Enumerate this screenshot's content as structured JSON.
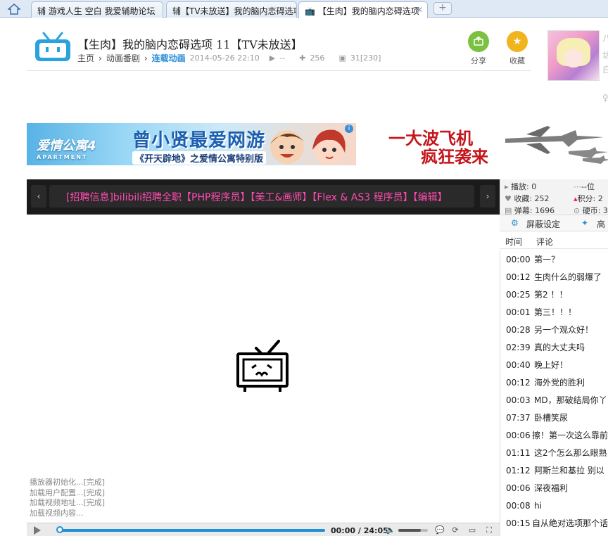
{
  "tabs": [
    {
      "label": "辅 游戏人生 空白 我爱辅助论坛",
      "active": false
    },
    {
      "label": "辅【TV未放送】我的脑内恋碍选项",
      "active": false
    },
    {
      "label": "【生肉】我的脑内恋碍选项",
      "active": true
    }
  ],
  "newtab": "+",
  "header": {
    "title": "【生肉】我的脑内恋碍选项 11【TV未放送】",
    "crumbs": [
      "主页",
      "动画番剧",
      "连载动画"
    ],
    "date": "2014-05-26 22:10",
    "plays": "--",
    "favs": "256",
    "danmaku": "31[230]",
    "share_label": "分享",
    "collect_label": "收藏"
  },
  "ads": {
    "ad1_brand": "爱情公寓4",
    "ad1_brand_sub": "APARTMENT",
    "ad1_big": "曾小贤最爱网游",
    "ad1_small": "《开天辟地》之爱情公寓特别版",
    "ad2_line1": "一大波飞机",
    "ad2_line2": "疯狂袭来"
  },
  "notice": {
    "message": "[招聘信息]bilibili招聘全职【PHP程序员】【美工&画师】【Flex & AS3 程序员】【编辑】"
  },
  "player": {
    "log": [
      "播放器初始化...[完成]",
      "加载用户配置...[完成]",
      "加载视频地址...[完成]",
      "加载视频内容..."
    ],
    "time_current": "00:00",
    "time_sep": "/",
    "time_total": "24:05",
    "progress": 0
  },
  "stats": {
    "plays": "播放: 0",
    "favs": "收藏: 252",
    "danmaku": "弹幕: 1696",
    "rank": "--位",
    "points": "积分: 2",
    "coins": "硬币: 3"
  },
  "panel": {
    "shield_label": "屏蔽设定",
    "hq_label": "高",
    "col_time": "时间",
    "col_comment": "评论"
  },
  "comments": [
    {
      "time": "00:00",
      "text": "第一？"
    },
    {
      "time": "00:12",
      "text": "生肉什么的弱爆了"
    },
    {
      "time": "00:25",
      "text": "第2 ！！"
    },
    {
      "time": "00:01",
      "text": "第三！！！"
    },
    {
      "time": "00:28",
      "text": "另一个观众好！"
    },
    {
      "time": "02:39",
      "text": "真的大丈夫吗"
    },
    {
      "time": "00:40",
      "text": "晚上好！"
    },
    {
      "time": "00:12",
      "text": "海外党的胜利"
    },
    {
      "time": "00:03",
      "text": "MD，那破结局你丫"
    },
    {
      "time": "07:37",
      "text": "卧槽笑尿"
    },
    {
      "time": "00:06",
      "text": "擦！第一次这么靠前"
    },
    {
      "time": "01:11",
      "text": "这2个怎么那么眼熟"
    },
    {
      "time": "01:12",
      "text": "阿斯兰和基拉  别以"
    },
    {
      "time": "00:06",
      "text": "深夜福利"
    },
    {
      "time": "00:08",
      "text": "hi"
    },
    {
      "time": "00:15",
      "text": "自从绝对选项那个话"
    }
  ]
}
